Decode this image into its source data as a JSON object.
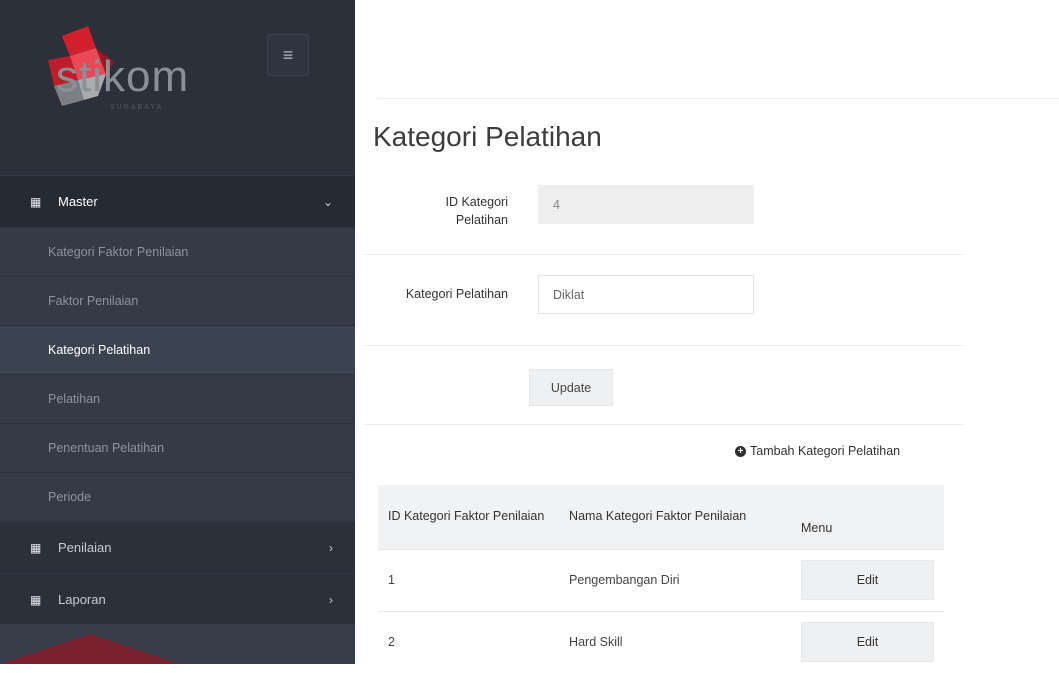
{
  "brand": {
    "logo_text": "stikom",
    "logo_sub": "SURABAYA",
    "menu_toggle_icon": "hamburger-icon"
  },
  "sidebar": {
    "groups": [
      {
        "label": "Master",
        "icon": "grid-icon",
        "chevron": "chevron-down-icon",
        "items": [
          "Kategori Faktor Penilaian",
          "Faktor Penilaian",
          "Kategori Pelatihan",
          "Pelatihan",
          "Penentuan Pelatihan",
          "Periode"
        ],
        "current": "Kategori Pelatihan"
      },
      {
        "label": "Penilaian",
        "icon": "grid-icon",
        "chevron": "chevron-right-icon"
      },
      {
        "label": "Laporan",
        "icon": "grid-icon",
        "chevron": "chevron-right-icon"
      }
    ]
  },
  "main": {
    "title": "Kategori Pelatihan",
    "form": {
      "id_label": "ID Kategori Pelatihan",
      "id_value": "4",
      "name_label": "Kategori Pelatihan",
      "name_value": "Diklat",
      "update_label": "Update"
    },
    "add_link": "Tambah Kategori Pelatihan",
    "table": {
      "headers": [
        "ID Kategori Faktor Penilaian",
        "Nama Kategori Faktor Penilaian",
        "Menu"
      ],
      "rows": [
        {
          "id": "1",
          "name": "Pengembangan Diri",
          "action": "Edit"
        },
        {
          "id": "2",
          "name": "Hard Skill",
          "action": "Edit"
        }
      ]
    }
  },
  "colors": {
    "sidebar_bg": "#2b303a",
    "logo_red": "#c8202f"
  }
}
